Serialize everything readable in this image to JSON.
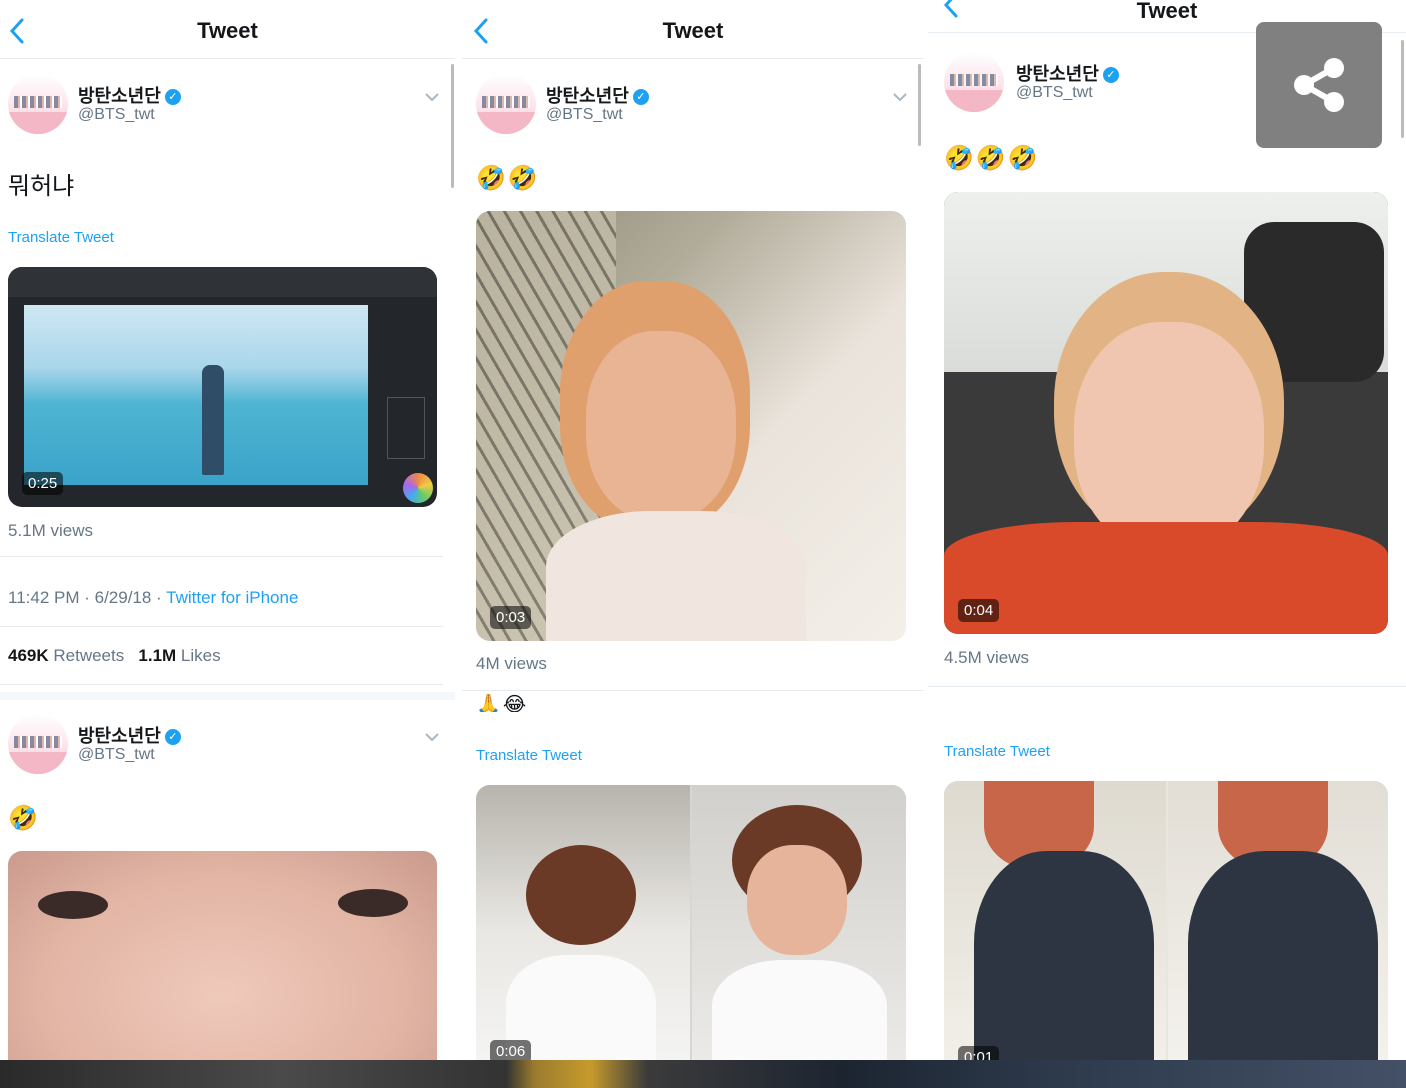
{
  "nav": {
    "title": "Tweet"
  },
  "account": {
    "name": "방탄소년단",
    "handle": "@BTS_twt",
    "verified_mark": "✓"
  },
  "translate_label": "Translate Tweet",
  "columns": [
    {
      "tweet": {
        "text": "뭐허냐",
        "media_duration": "0:25",
        "views": "5.1M views",
        "time": "11:42 PM · 6/29/18 · ",
        "source": "Twitter for iPhone",
        "retweets_count": "469K",
        "retweets_label": " Retweets",
        "likes_count": "1.1M",
        "likes_label": " Likes"
      },
      "next_tweet": {
        "emoji": "🤣"
      }
    },
    {
      "tweet": {
        "emoji": "🤣🤣",
        "media_duration": "0:03",
        "views": "4M views"
      },
      "next_tweet": {
        "emoji": "🙏😂",
        "media_duration": "0:06"
      }
    },
    {
      "tweet": {
        "emoji": "🤣🤣🤣",
        "media_duration": "0:04",
        "views": "4.5M views"
      },
      "next_tweet": {
        "media_duration": "0:01"
      }
    }
  ],
  "share_button": {
    "icon": "share-icon"
  },
  "colors": {
    "accent": "#1da1f2",
    "secondary_text": "#657786",
    "divider": "#e6ecf0"
  }
}
